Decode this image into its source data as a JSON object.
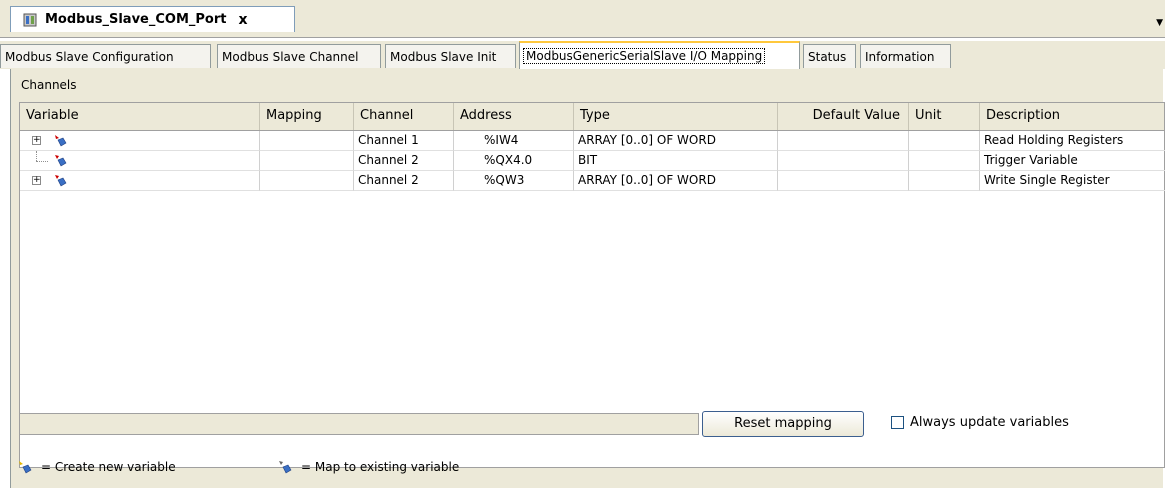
{
  "document_tab": {
    "title": "Modbus_Slave_COM_Port",
    "close": "x"
  },
  "config_tabs": [
    {
      "label": "Modbus Slave Configuration"
    },
    {
      "label": "Modbus Slave Channel"
    },
    {
      "label": "Modbus Slave Init"
    },
    {
      "label": "ModbusGenericSerialSlave I/O Mapping",
      "active": true
    },
    {
      "label": "Status"
    },
    {
      "label": "Information"
    }
  ],
  "panel": {
    "section_label": "Channels",
    "columns": [
      "Variable",
      "Mapping",
      "Channel",
      "Address",
      "Type",
      "Default Value",
      "Unit",
      "Description"
    ],
    "rows": [
      {
        "variable": "",
        "mapping": "",
        "channel": "Channel 1",
        "address": "%IW4",
        "type": "ARRAY [0..0] OF WORD",
        "default_value": "",
        "unit": "",
        "description": "Read Holding Registers",
        "expandable": true,
        "icon": "create-new-variable-icon"
      },
      {
        "variable": "",
        "mapping": "",
        "channel": "Channel 2",
        "address": "%QX4.0",
        "type": "BIT",
        "default_value": "",
        "unit": "",
        "description": "Trigger Variable",
        "expandable": false,
        "icon": "map-existing-variable-icon"
      },
      {
        "variable": "",
        "mapping": "",
        "channel": "Channel 2",
        "address": "%QW3",
        "type": "ARRAY [0..0] OF WORD",
        "default_value": "",
        "unit": "",
        "description": "Write Single Register",
        "expandable": true,
        "icon": "map-existing-variable-icon"
      }
    ],
    "reset_button": "Reset mapping",
    "always_update": {
      "label": "Always update variables",
      "checked": false
    }
  },
  "legend": {
    "create_new": "= Create new variable",
    "map_existing": "= Map to existing variable"
  },
  "colors": {
    "tab_bg": "#ece9d8",
    "active_tab_accent": "#ffc83c",
    "icon_red": "#cc0000",
    "icon_blue": "#3a6fc4"
  }
}
